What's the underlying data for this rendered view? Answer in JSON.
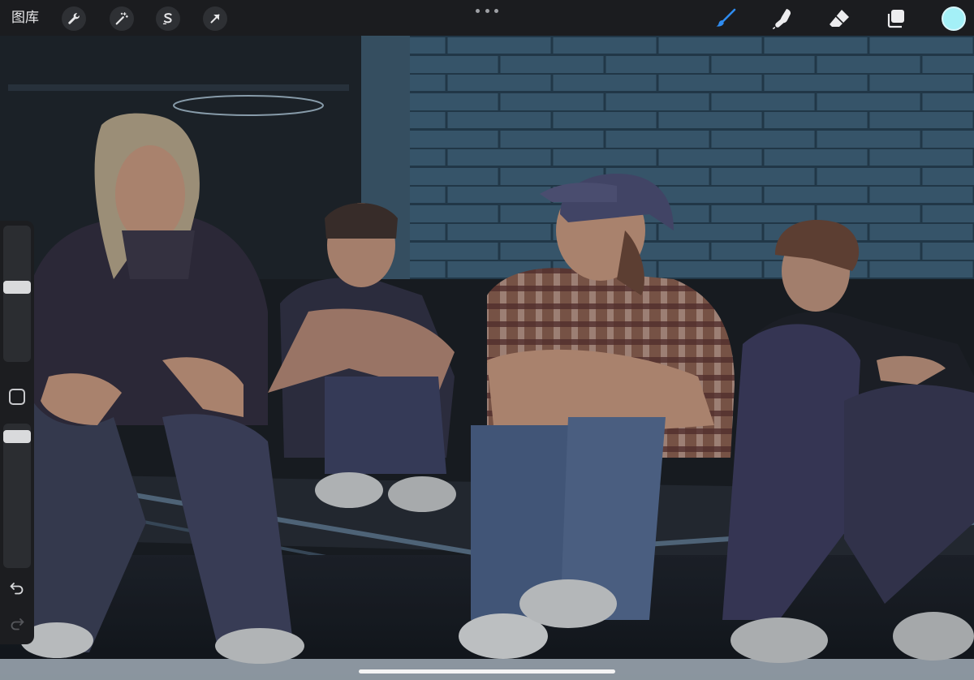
{
  "toolbar": {
    "gallery_label": "图库",
    "left_tools": [
      {
        "name": "actions",
        "icon": "wrench-icon"
      },
      {
        "name": "adjustments",
        "icon": "magic-wand-icon"
      },
      {
        "name": "selection",
        "icon": "selection-s-icon"
      },
      {
        "name": "transform",
        "icon": "arrow-cursor-icon"
      }
    ],
    "right_tools": [
      {
        "name": "brush",
        "icon": "brush-icon",
        "active": true
      },
      {
        "name": "smudge",
        "icon": "smudge-finger-icon"
      },
      {
        "name": "eraser",
        "icon": "eraser-icon"
      },
      {
        "name": "layers",
        "icon": "layers-icon"
      }
    ],
    "current_color": "#a4f0f7",
    "active_tool_color": "#2f8cf0"
  },
  "sidebar": {
    "brush_size_level": 0.55,
    "opacity_level": 0.95,
    "icons": [
      "modify-square-icon",
      "undo-icon",
      "redo-icon"
    ]
  },
  "artwork": {
    "palette": {
      "wall": "#3d5f77",
      "brick_line": "#2a4356",
      "shadow": "#15171c",
      "jacket": "#2f2837",
      "denim": "#3b3d5e",
      "skin": "#c99579",
      "flannel": "#8b5a47",
      "cap": "#4a4a6f",
      "hair_light": "#b7a486",
      "hair_brown": "#6b4231"
    }
  }
}
